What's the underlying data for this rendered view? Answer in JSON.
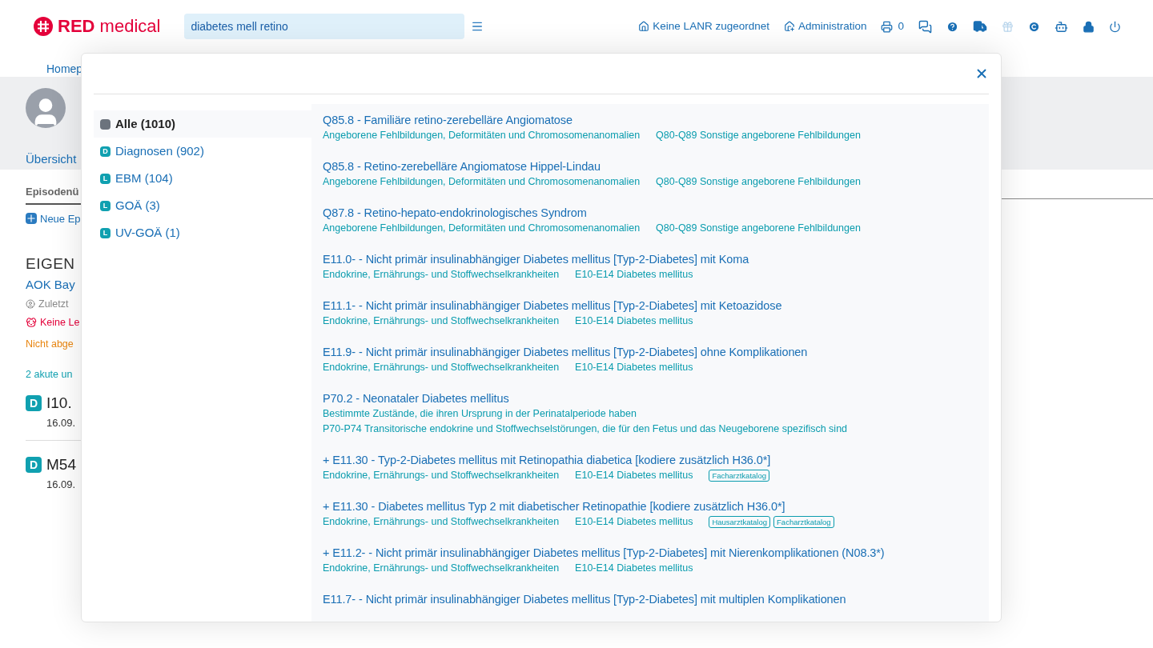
{
  "header": {
    "logo": {
      "bold": "RED",
      "light": "medical"
    },
    "search": {
      "value": "diabetes mell retino"
    },
    "links": [
      {
        "kind": "user-home",
        "label": "Keine LANR zugeordnet"
      },
      {
        "kind": "admin-home",
        "label": "Administration"
      }
    ],
    "print_count": "0"
  },
  "background": {
    "breadcrumb": "Homep",
    "tab": "Übersicht",
    "section_tab": "Episodenü",
    "new_episode": "Neue Ep",
    "insurance_type": "EIGEN",
    "insurer": "AOK Bay",
    "last_edited": "Zuletzt",
    "warning": "Keine Le",
    "status": "Nicht abge",
    "summary": "2 akute un",
    "diagnoses": [
      {
        "badge": "D",
        "code": "I10.",
        "date": "16.09."
      },
      {
        "badge": "D",
        "code": "M54",
        "date": "16.09."
      }
    ]
  },
  "dialog": {
    "categories": [
      {
        "kind": "all",
        "label": "Alle (1010)",
        "selected": true
      },
      {
        "kind": "letter",
        "badge": "D",
        "label": "Diagnosen (902)",
        "selected": false
      },
      {
        "kind": "letter",
        "badge": "L",
        "label": "EBM (104)",
        "selected": false
      },
      {
        "kind": "letter",
        "badge": "L",
        "label": "GOÄ (3)",
        "selected": false
      },
      {
        "kind": "letter",
        "badge": "L",
        "label": "UV-GOÄ (1)",
        "selected": false
      }
    ],
    "results": [
      {
        "title": "Q85.8 - Familiäre retino-zerebelläre Angiomatose",
        "chapter": "Angeborene Fehlbildungen, Deformitäten und Chromosomenanomalien",
        "group": "Q80-Q89 Sonstige angeborene Fehlbildungen"
      },
      {
        "title": "Q85.8 - Retino-zerebelläre Angiomatose Hippel-Lindau",
        "chapter": "Angeborene Fehlbildungen, Deformitäten und Chromosomenanomalien",
        "group": "Q80-Q89 Sonstige angeborene Fehlbildungen"
      },
      {
        "title": "Q87.8 - Retino-hepato-endokrinologisches Syndrom",
        "chapter": "Angeborene Fehlbildungen, Deformitäten und Chromosomenanomalien",
        "group": "Q80-Q89 Sonstige angeborene Fehlbildungen"
      },
      {
        "title": "E11.0- - Nicht primär insulinabhängiger Diabetes mellitus [Typ-2-Diabetes] mit Koma",
        "chapter": "Endokrine, Ernährungs- und Stoffwechselkrankheiten",
        "group": "E10-E14 Diabetes mellitus"
      },
      {
        "title": "E11.1- - Nicht primär insulinabhängiger Diabetes mellitus [Typ-2-Diabetes] mit Ketoazidose",
        "chapter": "Endokrine, Ernährungs- und Stoffwechselkrankheiten",
        "group": "E10-E14 Diabetes mellitus"
      },
      {
        "title": "E11.9- - Nicht primär insulinabhängiger Diabetes mellitus [Typ-2-Diabetes] ohne Komplikationen",
        "chapter": "Endokrine, Ernährungs- und Stoffwechselkrankheiten",
        "group": "E10-E14 Diabetes mellitus"
      },
      {
        "title": "P70.2 - Neonataler Diabetes mellitus",
        "chapter": "Bestimmte Zustände, die ihren Ursprung in der Perinatalperiode haben",
        "group": "P70-P74 Transitorische endokrine und Stoffwechselstörungen, die für den Fetus und das Neugeborene spezifisch sind"
      },
      {
        "title": "+ E11.30 - Typ-2-Diabetes mellitus mit Retinopathia diabetica [kodiere zusätzlich H36.0*]",
        "chapter": "Endokrine, Ernährungs- und Stoffwechselkrankheiten",
        "group": "E10-E14 Diabetes mellitus",
        "tags": [
          "Facharztkatalog"
        ]
      },
      {
        "title": "+ E11.30 - Diabetes mellitus Typ 2 mit diabetischer Retinopathie [kodiere zusätzlich H36.0*]",
        "chapter": "Endokrine, Ernährungs- und Stoffwechselkrankheiten",
        "group": "E10-E14 Diabetes mellitus",
        "tags": [
          "Hausarztkatalog",
          "Facharztkatalog"
        ]
      },
      {
        "title": "+ E11.2- - Nicht primär insulinabhängiger Diabetes mellitus [Typ-2-Diabetes] mit Nierenkomplikationen (N08.3*)",
        "chapter": "Endokrine, Ernährungs- und Stoffwechselkrankheiten",
        "group": "E10-E14 Diabetes mellitus"
      },
      {
        "title": "E11.7- - Nicht primär insulinabhängiger Diabetes mellitus [Typ-2-Diabetes] mit multiplen Komplikationen"
      }
    ]
  }
}
